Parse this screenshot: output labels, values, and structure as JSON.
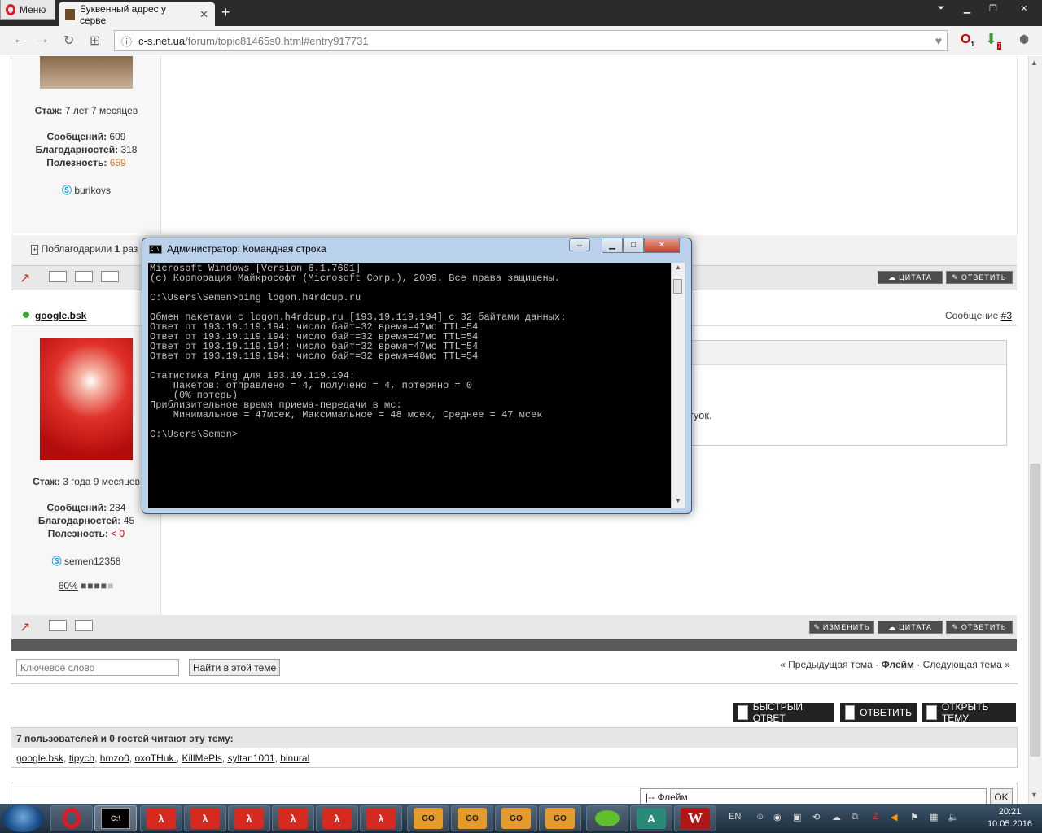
{
  "browser": {
    "menu_label": "Меню",
    "tab_title": "Буквенный адрес у серве",
    "url_host": "c-s.net.ua",
    "url_path": "/forum/topic81465s0.html#entry917731",
    "badge_1": "1",
    "badge_2": "7"
  },
  "post1": {
    "stazh_label": "Стаж:",
    "stazh_value": "7 лет 7 месяцев",
    "msgs_label": "Сообщений:",
    "msgs_value": "609",
    "thanks_label": "Благодарностей:",
    "thanks_value": "318",
    "useful_label": "Полезность:",
    "useful_value": "659",
    "skype": "burikovs",
    "thanked_prefix": "Поблагодарили",
    "thanked_count": "1",
    "thanked_suffix": "раз"
  },
  "post2": {
    "author": "google.bsk",
    "msg_label": "Сообщение",
    "msg_num": "#3",
    "stazh_label": "Стаж:",
    "stazh_value": "3 года 9 месяцев",
    "msgs_label": "Сообщений:",
    "msgs_value": "284",
    "thanks_label": "Благодарностей:",
    "thanks_value": "45",
    "useful_label": "Полезность:",
    "useful_value": "< 0",
    "skype": "semen12358",
    "warn_percent": "60%",
    "body_fragment": "гуок."
  },
  "buttons": {
    "quote": "ЦИТАТА",
    "reply": "ОТВЕТИТЬ",
    "edit": "ИЗМЕНИТЬ",
    "quick_reply": "БЫСТРЫЙ ОТВЕТ",
    "reply_big": "ОТВЕТИТЬ",
    "open_topic": "ОТКРЫТЬ ТЕМУ"
  },
  "search": {
    "placeholder": "Ключевое слово",
    "button": "Найти в этой теме"
  },
  "topic_nav": {
    "prev": "« Предыдущая тема",
    "sep1": "·",
    "current": "Флейм",
    "sep2": "·",
    "next": "Следующая тема »"
  },
  "readers": {
    "title": "7 пользователей и 0 гостей читают эту тему:",
    "users": [
      "google.bsk",
      "tipych",
      "hmzo0",
      "oxoTHuk.",
      "KillMePls",
      "syltan1001",
      "binural"
    ]
  },
  "jump": {
    "selected": "|-- Флейм",
    "ok": "OK"
  },
  "cmd": {
    "title": "Администратор: Командная строка",
    "lines": [
      "Microsoft Windows [Version 6.1.7601]",
      "(c) Корпорация Майкрософт (Microsoft Corp.), 2009. Все права защищены.",
      "",
      "C:\\Users\\Semen>ping logon.h4rdcup.ru",
      "",
      "Обмен пакетами с logon.h4rdcup.ru [193.19.119.194] с 32 байтами данных:",
      "Ответ от 193.19.119.194: число байт=32 время=47мс TTL=54",
      "Ответ от 193.19.119.194: число байт=32 время=47мс TTL=54",
      "Ответ от 193.19.119.194: число байт=32 время=47мс TTL=54",
      "Ответ от 193.19.119.194: число байт=32 время=48мс TTL=54",
      "",
      "Статистика Ping для 193.19.119.194:",
      "    Пакетов: отправлено = 4, получено = 4, потеряно = 0",
      "    (0% потерь)",
      "Приблизительное время приема-передачи в мс:",
      "    Минимальное = 47мсек, Максимальное = 48 мсек, Среднее = 47 мсек",
      "",
      "C:\\Users\\Semen>"
    ]
  },
  "taskbar": {
    "lang": "EN",
    "time": "20:21",
    "date": "10.05.2016",
    "cmd_icon": "C:\\",
    "csgo": "GO",
    "hl": "λ",
    "w": "W"
  }
}
